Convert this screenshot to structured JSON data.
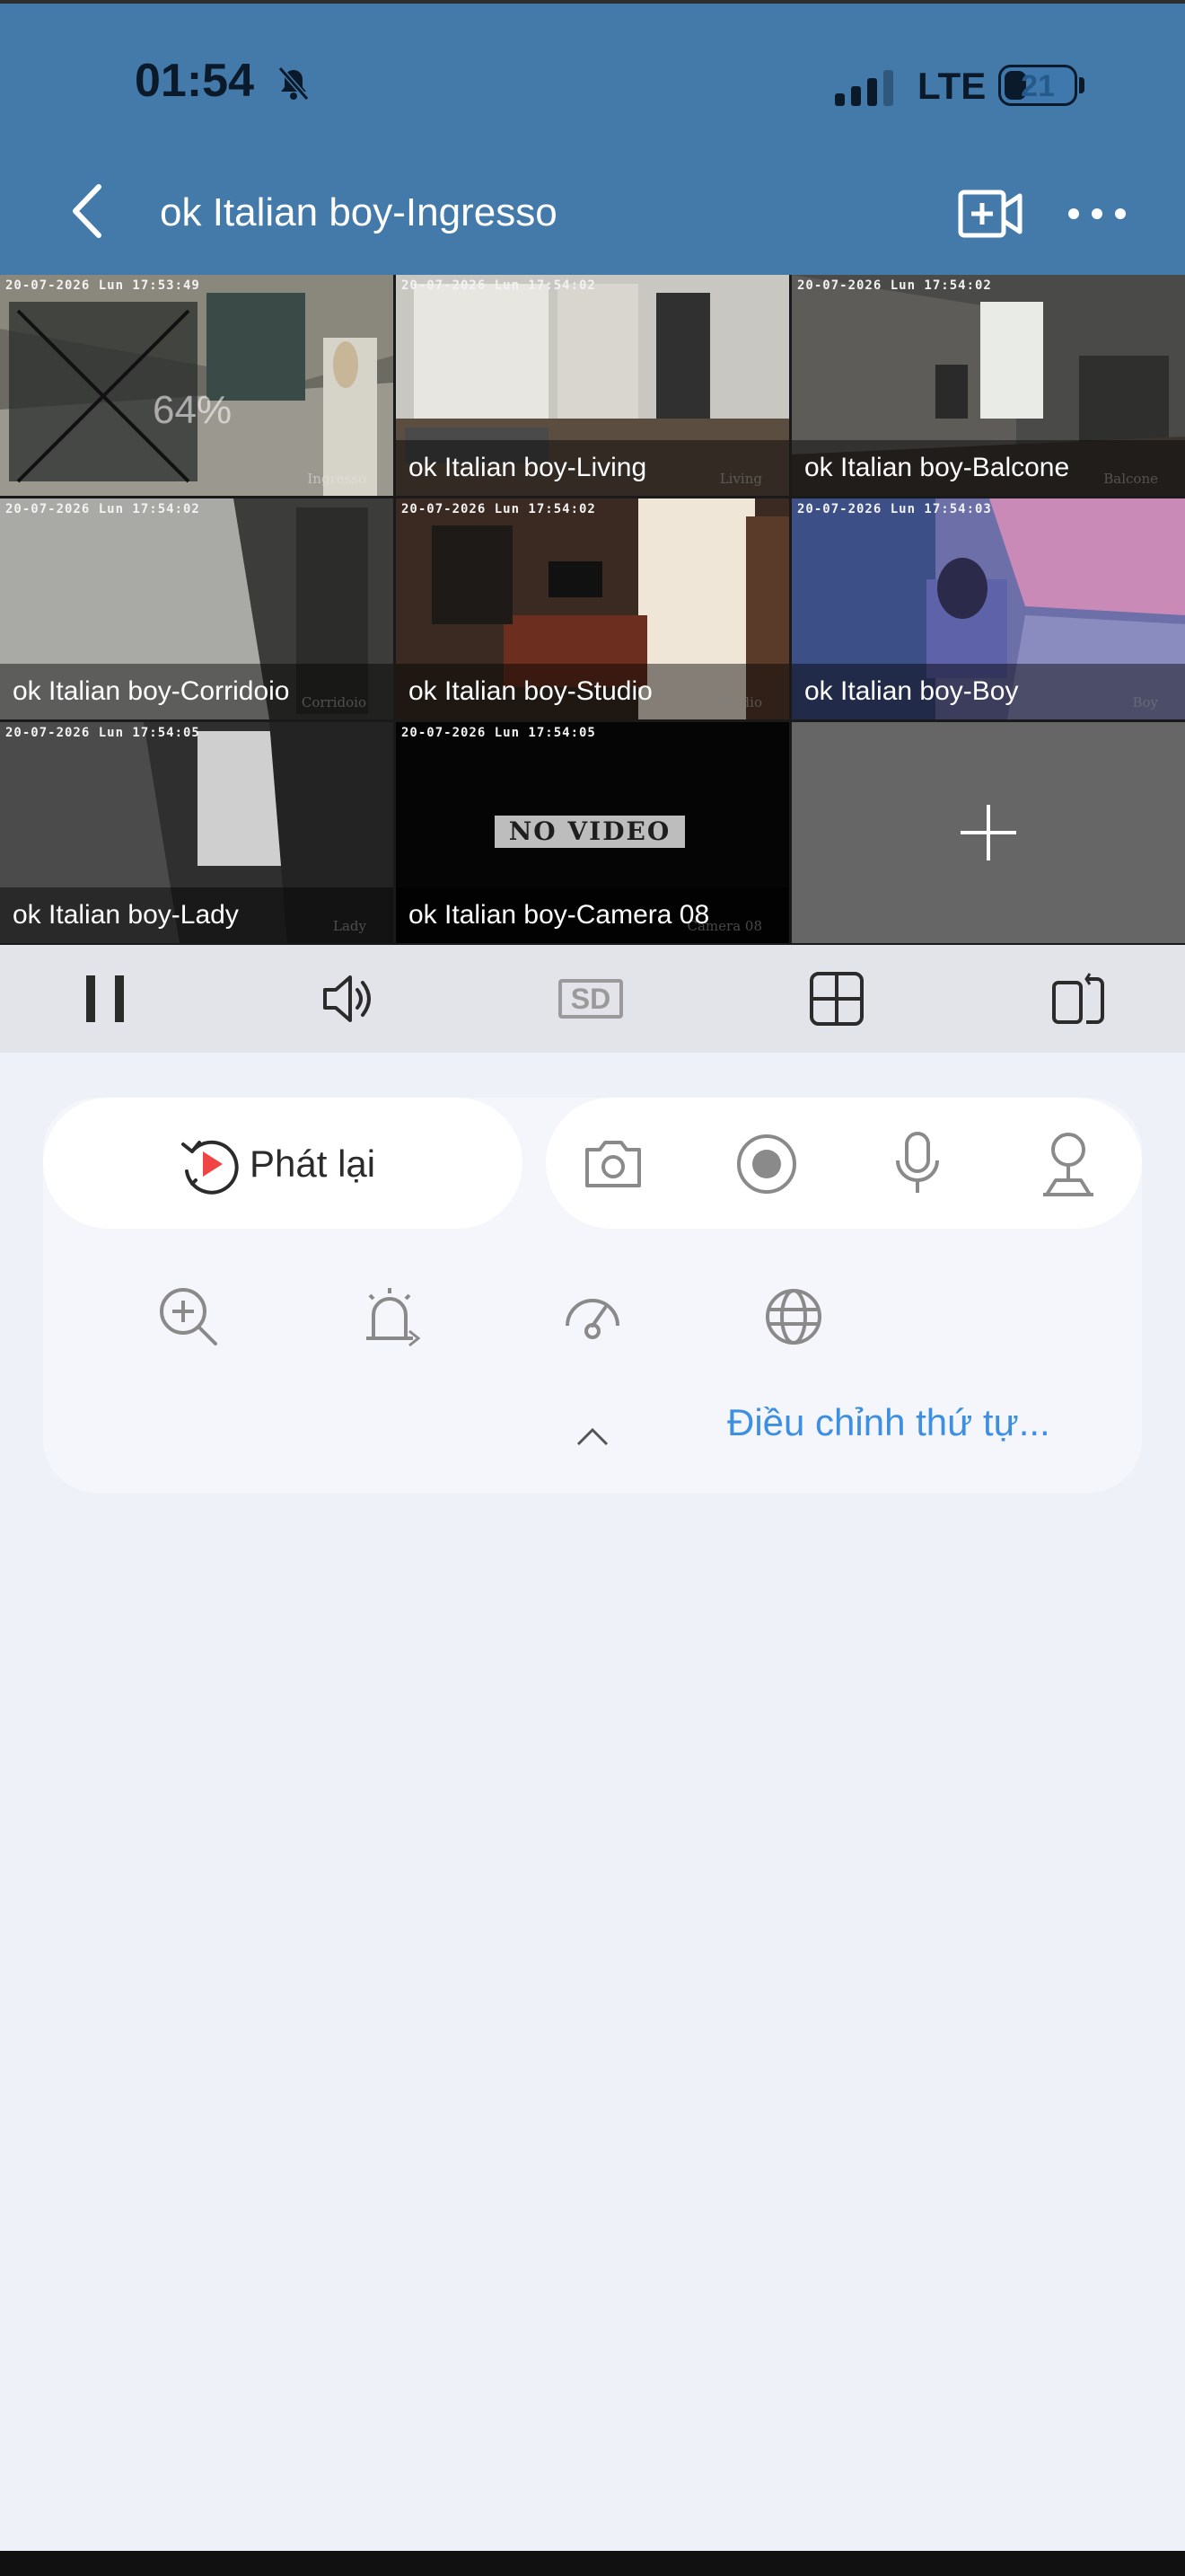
{
  "status_bar": {
    "time": "01:54",
    "bell_icon": "bell-muted-icon",
    "network": "LTE",
    "battery": "21"
  },
  "header": {
    "back_icon": "chevron-left-icon",
    "title": "ok Italian boy-Ingresso",
    "add_camera_icon": "video-add-icon",
    "more_icon": "more-horizontal-icon"
  },
  "cameras": [
    {
      "label": "",
      "timestamp": "20-07-2026 Lun 17:53:49",
      "osd": "Ingresso",
      "loading": "64%",
      "selected": true
    },
    {
      "label": "ok Italian boy-Living",
      "timestamp": "20-07-2026 Lun 17:54:02",
      "osd": "Living"
    },
    {
      "label": "ok Italian boy-Balcone",
      "timestamp": "20-07-2026 Lun 17:54:02",
      "osd": "Balcone"
    },
    {
      "label": "ok Italian boy-Corridoio",
      "timestamp": "20-07-2026 Lun 17:54:02",
      "osd": "Corridoio"
    },
    {
      "label": "ok Italian boy-Studio",
      "timestamp": "20-07-2026 Lun 17:54:02",
      "osd": "Studio"
    },
    {
      "label": "ok Italian boy-Boy",
      "timestamp": "20-07-2026 Lun 17:54:03",
      "osd": "Boy"
    },
    {
      "label": "ok Italian boy-Lady",
      "timestamp": "20-07-2026 Lun 17:54:05",
      "osd": "Lady"
    },
    {
      "label": "ok Italian boy-Camera 08",
      "timestamp": "20-07-2026 Lun 17:54:05",
      "osd": "Camera 08",
      "no_video": "NO VIDEO"
    }
  ],
  "add_tile_icon": "plus-icon",
  "controls": {
    "pause_icon": "pause-icon",
    "volume_icon": "speaker-icon",
    "quality": "SD",
    "layout_icon": "grid-icon",
    "screen_icon": "rotate-screen-icon"
  },
  "actions": {
    "playback_label": "Phát lại",
    "playback_icon": "replay-icon",
    "tools": [
      "camera-icon",
      "record-icon",
      "microphone-icon",
      "ptz-icon"
    ],
    "tools_row2": [
      "zoom-in-icon",
      "alarm-icon",
      "speed-dome-icon",
      "globe-icon"
    ],
    "adjust_order": "Điều chỉnh thứ tự...",
    "accent_color": "#3d8fe0",
    "header_color": "#437aaa"
  }
}
